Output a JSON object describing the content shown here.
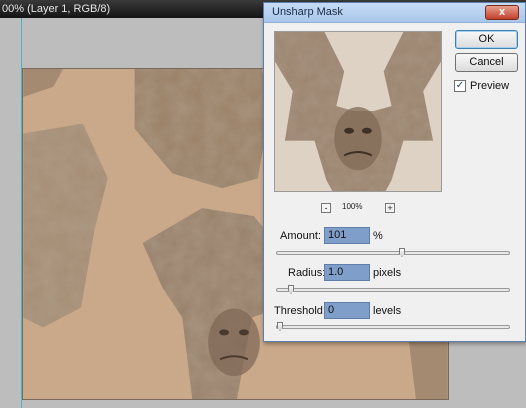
{
  "document": {
    "title": "00% (Layer 1, RGB/8)"
  },
  "dialog": {
    "title": "Unsharp Mask",
    "close_label": "x",
    "ok_label": "OK",
    "cancel_label": "Cancel",
    "preview_label": "Preview",
    "preview_checked": true,
    "preview_check_glyph": "✓",
    "zoom": {
      "minus_label": "-",
      "level": "100%",
      "plus_label": "+"
    },
    "amount": {
      "label": "Amount:",
      "value": "101",
      "unit": "%",
      "slider_fraction": 0.54
    },
    "radius": {
      "label": "Radius:",
      "value": "1.0",
      "unit": "pixels",
      "slider_fraction": 0.05
    },
    "threshold": {
      "label": "Threshold:",
      "value": "0",
      "unit": "levels",
      "slider_fraction": 0.0
    }
  },
  "colors": {
    "canvas_tan": "#c9a98a",
    "texture_brown": "#8a7560",
    "guide_cyan": "#2fb8c4",
    "field_highlight": "#7f9fca"
  }
}
